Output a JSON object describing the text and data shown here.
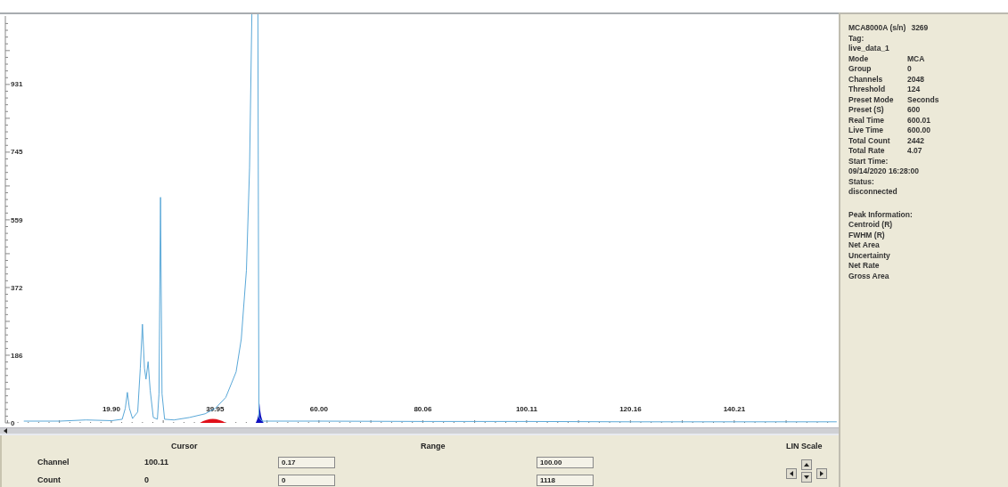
{
  "plot": {
    "chart_data": {
      "type": "line",
      "xlim": [
        -1.6,
        160.2
      ],
      "ylim": [
        0,
        1118
      ],
      "yticks": [
        0,
        186,
        372,
        559,
        745,
        931
      ],
      "xticks": [
        {
          "value": 19.9,
          "label": "19.90"
        },
        {
          "value": 39.95,
          "label": "39.95"
        },
        {
          "value": 60,
          "label": "60.00"
        },
        {
          "value": 80.06,
          "label": "80.06"
        },
        {
          "value": 100.11,
          "label": "100.11"
        },
        {
          "value": 120.16,
          "label": "120.16"
        },
        {
          "value": 140.21,
          "label": "140.21"
        }
      ],
      "x": [
        3,
        10,
        15,
        20,
        22,
        22.6,
        23,
        23.4,
        24,
        25,
        25.5,
        25.9,
        26.3,
        26.6,
        27,
        27.4,
        28,
        28.8,
        29.1,
        29.4,
        29.7,
        30.2,
        32,
        35,
        38,
        40,
        42,
        44,
        45,
        46,
        46.6,
        47.1,
        48.2,
        48.4,
        49,
        60,
        80,
        100,
        120,
        140,
        160
      ],
      "series": [
        {
          "color": "#5aa8d8",
          "values": [
            5,
            5,
            8,
            6,
            10,
            40,
            84,
            40,
            12,
            30,
            150,
            271,
            150,
            120,
            168,
            90,
            15,
            10,
            80,
            620,
            80,
            10,
            8,
            15,
            25,
            40,
            70,
            140,
            230,
            420,
            700,
            null,
            null,
            15,
            5,
            5,
            4,
            4,
            3,
            3,
            3
          ]
        }
      ]
    }
  },
  "readout": {
    "cursor_header": "Cursor",
    "range_header": "Range",
    "scale_label": "LIN Scale",
    "rows": [
      {
        "label": "Channel",
        "cursor": "100.11",
        "range_low": "0.17",
        "range_high": "100.00"
      },
      {
        "label": "Count",
        "cursor": "0",
        "range_low": "0",
        "range_high": "1118"
      }
    ]
  },
  "device_info": [
    {
      "label": "MCA8000A (s/n)",
      "value": "3269"
    },
    {
      "label": "Tag:"
    },
    {
      "label": "live_data_1"
    },
    {
      "label": "Mode",
      "value": "MCA"
    },
    {
      "label": "Group",
      "value": "0"
    },
    {
      "label": "Channels",
      "value": "2048"
    },
    {
      "label": "Threshold",
      "value": "124"
    },
    {
      "label": "Preset Mode",
      "value": "Seconds"
    },
    {
      "label": "Preset (S)",
      "value": "600"
    },
    {
      "label": "Real Time",
      "value": "600.01"
    },
    {
      "label": "Live Time",
      "value": "600.00"
    },
    {
      "label": "Total Count",
      "value": "2442"
    },
    {
      "label": "Total Rate",
      "value": "4.07"
    },
    {
      "label": "Start Time:"
    },
    {
      "label": "09/14/2020 16:28:00"
    },
    {
      "label": "Status:"
    },
    {
      "label": "disconnected"
    }
  ],
  "peak_information": [
    {
      "label": "Peak Information:"
    },
    {
      "label": "Centroid (R)"
    },
    {
      "label": "FWHM (R)"
    },
    {
      "label": "Net Area"
    },
    {
      "label": "Uncertainty"
    },
    {
      "label": "Net Rate"
    },
    {
      "label": "Gross Area"
    }
  ]
}
